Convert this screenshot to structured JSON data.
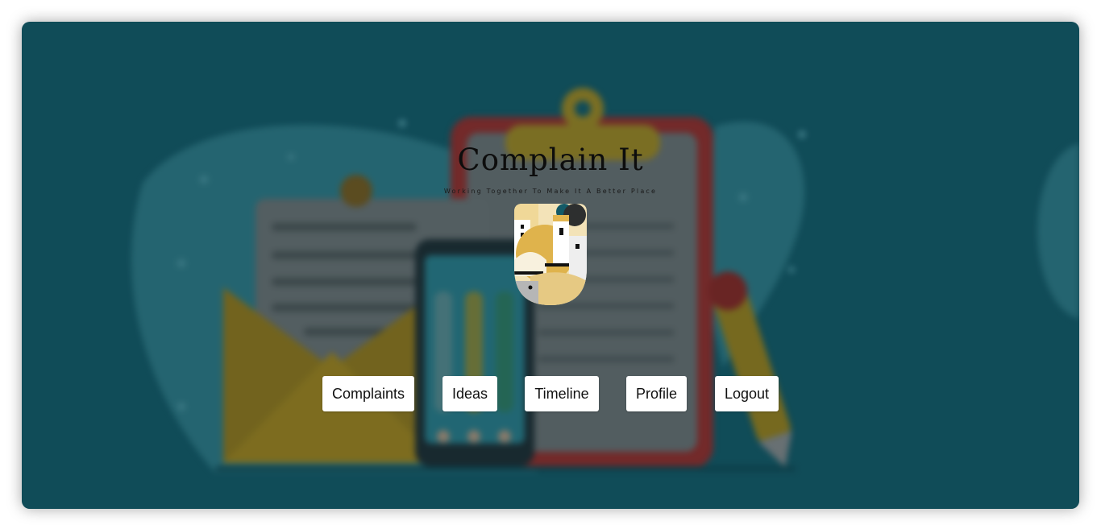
{
  "brand": {
    "title": "Complain It",
    "tagline": "Working Together To Make It A Better Place"
  },
  "nav": {
    "complaints": "Complaints",
    "ideas": "Ideas",
    "timeline": "Timeline",
    "profile": "Profile",
    "logout": "Logout"
  },
  "colors": {
    "background": "#135a67",
    "clipboard": "#b5322e",
    "envelope": "#d4a521",
    "button": "#ffffff"
  },
  "icons": [
    "clipboard-illustration",
    "envelope-illustration",
    "phone-illustration",
    "pencil-illustration",
    "city-logo-icon"
  ]
}
